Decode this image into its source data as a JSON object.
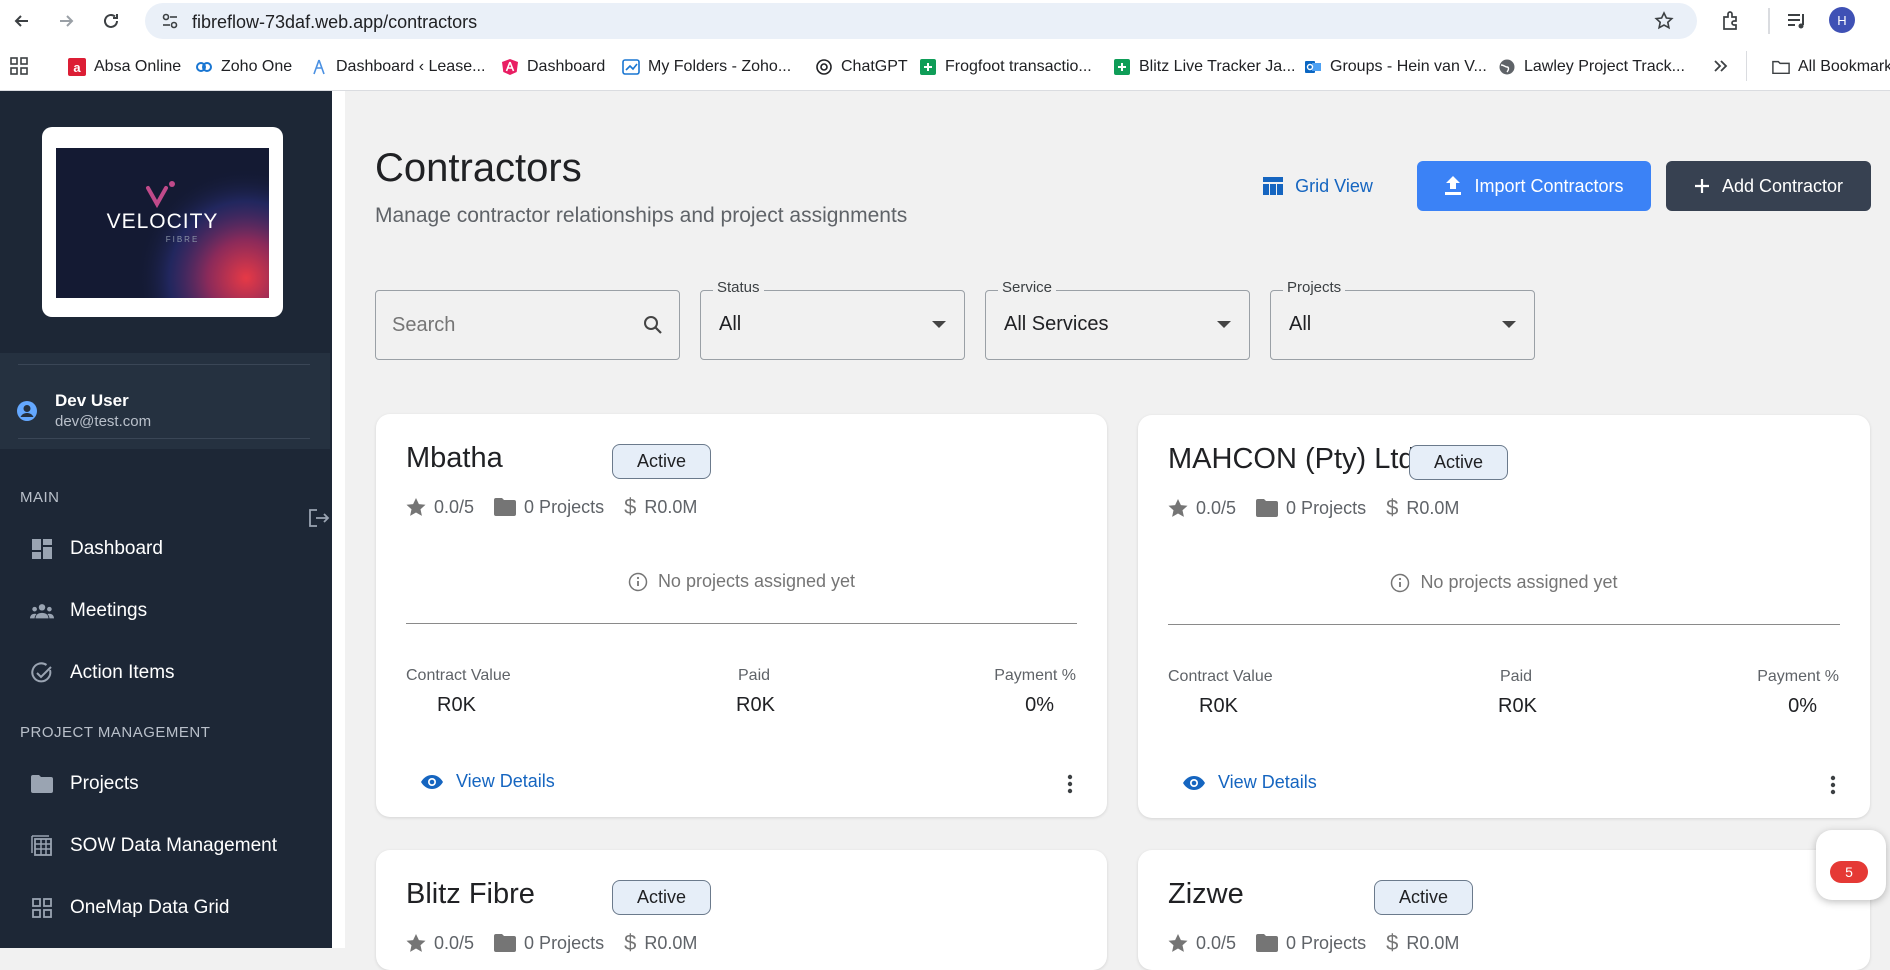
{
  "browser": {
    "url": "fibreflow-73daf.web.app/contractors",
    "profile_initial": "H",
    "bookmarks": [
      {
        "label": "Absa Online",
        "icon": "absa-icon",
        "color": "#dc1e35"
      },
      {
        "label": "Zoho One",
        "icon": "zoho-icon",
        "color": "#1976d2"
      },
      {
        "label": "Dashboard ‹ Lease...",
        "icon": "lease-icon",
        "color": "#4a90e2"
      },
      {
        "label": "Dashboard",
        "icon": "angular-icon",
        "color": "#e91e63"
      },
      {
        "label": "My Folders - Zoho...",
        "icon": "folder-chart-icon",
        "color": "#1976d2"
      },
      {
        "label": "ChatGPT",
        "icon": "chatgpt-icon",
        "color": "#202124"
      },
      {
        "label": "Frogfoot transactio...",
        "icon": "sheets-icon",
        "color": "#0f9d58"
      },
      {
        "label": "Blitz Live Tracker Ja...",
        "icon": "sheets-icon",
        "color": "#0f9d58"
      },
      {
        "label": "Groups - Hein van V...",
        "icon": "outlook-icon",
        "color": "#0a66c2"
      },
      {
        "label": "Lawley Project Track...",
        "icon": "globe-icon",
        "color": "#5f6368"
      }
    ],
    "all_bookmarks": "All Bookmarks"
  },
  "sidebar": {
    "logo_text": "VELOCITY",
    "logo_sub": "FIBRE",
    "user": {
      "name": "Dev User",
      "email": "dev@test.com"
    },
    "sections": [
      {
        "title": "MAIN",
        "items": [
          {
            "label": "Dashboard",
            "icon": "dashboard-icon"
          },
          {
            "label": "Meetings",
            "icon": "people-icon"
          },
          {
            "label": "Action Items",
            "icon": "check-circle-icon"
          }
        ]
      },
      {
        "title": "PROJECT MANAGEMENT",
        "items": [
          {
            "label": "Projects",
            "icon": "folder-icon"
          },
          {
            "label": "SOW Data Management",
            "icon": "table-icon"
          },
          {
            "label": "OneMap Data Grid",
            "icon": "grid-icon"
          }
        ]
      }
    ]
  },
  "page": {
    "title": "Contractors",
    "subtitle": "Manage contractor relationships and project assignments",
    "grid_view": "Grid View",
    "import": "Import Contractors",
    "add": "Add Contractor"
  },
  "filters": {
    "search_placeholder": "Search",
    "status": {
      "label": "Status",
      "value": "All"
    },
    "service": {
      "label": "Service",
      "value": "All Services"
    },
    "projects": {
      "label": "Projects",
      "value": "All"
    }
  },
  "contractors": [
    {
      "name": "Mbatha",
      "status": "Active",
      "rating": "0.0/5",
      "projects": "0 Projects",
      "value": "R0.0M",
      "empty": "No projects assigned yet",
      "contract_value_label": "Contract Value",
      "contract_value": "R0K",
      "paid_label": "Paid",
      "paid": "R0K",
      "payment_label": "Payment %",
      "payment": "0%",
      "view": "View Details"
    },
    {
      "name": "MAHCON (Pty) Ltd",
      "status": "Active",
      "rating": "0.0/5",
      "projects": "0 Projects",
      "value": "R0.0M",
      "empty": "No projects assigned yet",
      "contract_value_label": "Contract Value",
      "contract_value": "R0K",
      "paid_label": "Paid",
      "paid": "R0K",
      "payment_label": "Payment %",
      "payment": "0%",
      "view": "View Details"
    },
    {
      "name": "Blitz Fibre",
      "status": "Active",
      "rating": "0.0/5",
      "projects": "0 Projects",
      "value": "R0.0M"
    },
    {
      "name": "Zizwe",
      "status": "Active",
      "rating": "0.0/5",
      "projects": "0 Projects",
      "value": "R0.0M"
    }
  ],
  "chat_badge": "5",
  "colors": {
    "accent": "#3b82f6",
    "dark_button": "#374151",
    "link": "#1565c0",
    "sidebar": "#1d2736"
  }
}
